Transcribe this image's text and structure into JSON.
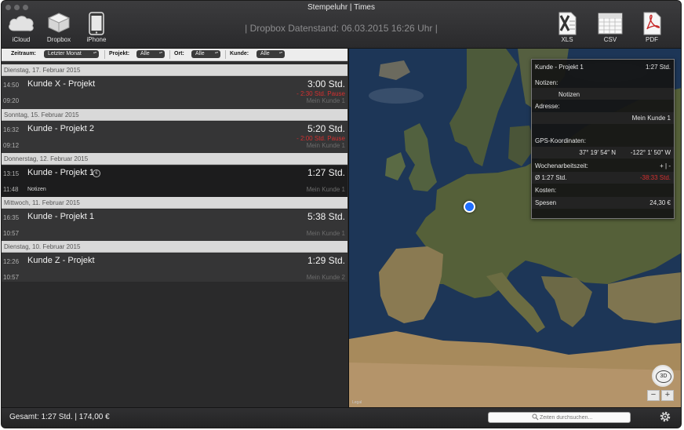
{
  "window": {
    "title": "Stempeluhr | Times"
  },
  "toolbar": {
    "left_buttons": [
      {
        "label": "iCloud",
        "icon": "cloud-icon"
      },
      {
        "label": "Dropbox",
        "icon": "dropbox-icon"
      },
      {
        "label": "iPhone",
        "icon": "iphone-icon"
      }
    ],
    "status": "| Dropbox Datenstand: 06.03.2015 16:26 Uhr |",
    "export_buttons": [
      {
        "label": "XLS",
        "icon": "xls-icon"
      },
      {
        "label": "CSV",
        "icon": "csv-icon"
      },
      {
        "label": "PDF",
        "icon": "pdf-icon"
      }
    ]
  },
  "filters": {
    "zeitraum": {
      "label": "Zeitraum:",
      "value": "Letzter Monat"
    },
    "projekt": {
      "label": "Projekt:",
      "value": "Alle"
    },
    "ort": {
      "label": "Ort:",
      "value": "Alle"
    },
    "kunde": {
      "label": "Kunde:",
      "value": "Alle"
    }
  },
  "entries": [
    {
      "date": "Dienstag, 17. Februar 2015",
      "start": "14:50",
      "end": "09:20",
      "title": "Kunde X - Projekt",
      "duration": "3:00 Std.",
      "pause": "- 2:30 Std. Pause",
      "client": "Mein Kunde 1",
      "note": ""
    },
    {
      "date": "Sonntag, 15. Februar 2015",
      "start": "16:32",
      "end": "09:12",
      "title": "Kunde - Projekt 2",
      "duration": "5:20 Std.",
      "pause": "- 2:00 Std. Pause",
      "client": "Mein Kunde 1",
      "note": ""
    },
    {
      "date": "Donnerstag, 12. Februar 2015",
      "start": "13:15",
      "end": "11:48",
      "title": "Kunde - Projekt 1",
      "duration": "1:27 Std.",
      "pause": "",
      "client": "Mein Kunde 1",
      "note": "Notizen",
      "info_icon": "€"
    },
    {
      "date": "Mittwoch, 11. Februar 2015",
      "start": "16:35",
      "end": "10:57",
      "title": "Kunde - Projekt 1",
      "duration": "5:38 Std.",
      "pause": "",
      "client": "Mein Kunde 1",
      "note": ""
    },
    {
      "date": "Dienstag, 10. Februar 2015",
      "start": "12:26",
      "end": "10:57",
      "title": "Kunde Z - Projekt",
      "duration": "1:29 Std.",
      "pause": "",
      "client": "Mein Kunde 2",
      "note": ""
    }
  ],
  "detail": {
    "title": "Kunde - Projekt 1",
    "duration": "1:27 Std.",
    "notizen_label": "Notizen:",
    "notizen_value": "Notizen",
    "adresse_label": "Adresse:",
    "adresse_value": "Mein Kunde 1",
    "gps_label": "GPS-Koordinaten:",
    "gps_lat": "37° 19′ 54″ N",
    "gps_lon": "-122° 1′ 50″ W",
    "woche_label": "Wochenarbeitszeit:",
    "woche_controls": "+ | -",
    "avg_label": "Ø 1:27 Std.",
    "avg_value": "-38:33 Std.",
    "kosten_label": "Kosten:",
    "spesen_label": "Spesen",
    "spesen_value": "24,30 €"
  },
  "map": {
    "button_3d": "3D",
    "zoom_out": "−",
    "zoom_in": "+",
    "legal": "Legal"
  },
  "footer": {
    "total": "Gesamt: 1:27 Std. | 174,00 €",
    "search_placeholder": "Zeiten durchsuchen..."
  },
  "colors": {
    "accent_pin": "#1f6fff",
    "pause_red": "#d43030"
  }
}
